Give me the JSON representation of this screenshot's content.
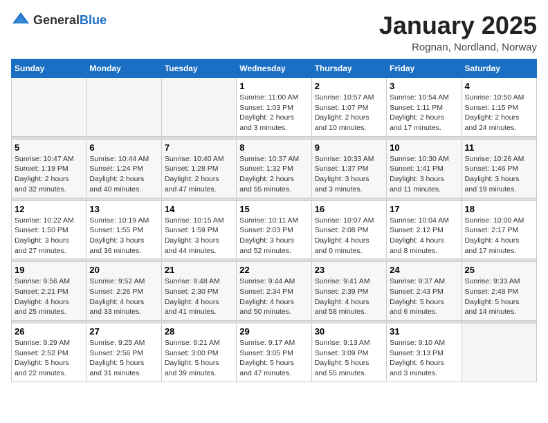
{
  "logo": {
    "general": "General",
    "blue": "Blue"
  },
  "title": "January 2025",
  "subtitle": "Rognan, Nordland, Norway",
  "headers": [
    "Sunday",
    "Monday",
    "Tuesday",
    "Wednesday",
    "Thursday",
    "Friday",
    "Saturday"
  ],
  "weeks": [
    {
      "days": [
        {
          "num": "",
          "info": "",
          "empty": true
        },
        {
          "num": "",
          "info": "",
          "empty": true
        },
        {
          "num": "",
          "info": "",
          "empty": true
        },
        {
          "num": "1",
          "info": "Sunrise: 11:00 AM\nSunset: 1:03 PM\nDaylight: 2 hours\nand 3 minutes."
        },
        {
          "num": "2",
          "info": "Sunrise: 10:57 AM\nSunset: 1:07 PM\nDaylight: 2 hours\nand 10 minutes."
        },
        {
          "num": "3",
          "info": "Sunrise: 10:54 AM\nSunset: 1:11 PM\nDaylight: 2 hours\nand 17 minutes."
        },
        {
          "num": "4",
          "info": "Sunrise: 10:50 AM\nSunset: 1:15 PM\nDaylight: 2 hours\nand 24 minutes."
        }
      ]
    },
    {
      "days": [
        {
          "num": "5",
          "info": "Sunrise: 10:47 AM\nSunset: 1:19 PM\nDaylight: 2 hours\nand 32 minutes."
        },
        {
          "num": "6",
          "info": "Sunrise: 10:44 AM\nSunset: 1:24 PM\nDaylight: 2 hours\nand 40 minutes."
        },
        {
          "num": "7",
          "info": "Sunrise: 10:40 AM\nSunset: 1:28 PM\nDaylight: 2 hours\nand 47 minutes."
        },
        {
          "num": "8",
          "info": "Sunrise: 10:37 AM\nSunset: 1:32 PM\nDaylight: 2 hours\nand 55 minutes."
        },
        {
          "num": "9",
          "info": "Sunrise: 10:33 AM\nSunset: 1:37 PM\nDaylight: 3 hours\nand 3 minutes."
        },
        {
          "num": "10",
          "info": "Sunrise: 10:30 AM\nSunset: 1:41 PM\nDaylight: 3 hours\nand 11 minutes."
        },
        {
          "num": "11",
          "info": "Sunrise: 10:26 AM\nSunset: 1:46 PM\nDaylight: 3 hours\nand 19 minutes."
        }
      ]
    },
    {
      "days": [
        {
          "num": "12",
          "info": "Sunrise: 10:22 AM\nSunset: 1:50 PM\nDaylight: 3 hours\nand 27 minutes."
        },
        {
          "num": "13",
          "info": "Sunrise: 10:19 AM\nSunset: 1:55 PM\nDaylight: 3 hours\nand 36 minutes."
        },
        {
          "num": "14",
          "info": "Sunrise: 10:15 AM\nSunset: 1:59 PM\nDaylight: 3 hours\nand 44 minutes."
        },
        {
          "num": "15",
          "info": "Sunrise: 10:11 AM\nSunset: 2:03 PM\nDaylight: 3 hours\nand 52 minutes."
        },
        {
          "num": "16",
          "info": "Sunrise: 10:07 AM\nSunset: 2:08 PM\nDaylight: 4 hours\nand 0 minutes."
        },
        {
          "num": "17",
          "info": "Sunrise: 10:04 AM\nSunset: 2:12 PM\nDaylight: 4 hours\nand 8 minutes."
        },
        {
          "num": "18",
          "info": "Sunrise: 10:00 AM\nSunset: 2:17 PM\nDaylight: 4 hours\nand 17 minutes."
        }
      ]
    },
    {
      "days": [
        {
          "num": "19",
          "info": "Sunrise: 9:56 AM\nSunset: 2:21 PM\nDaylight: 4 hours\nand 25 minutes."
        },
        {
          "num": "20",
          "info": "Sunrise: 9:52 AM\nSunset: 2:26 PM\nDaylight: 4 hours\nand 33 minutes."
        },
        {
          "num": "21",
          "info": "Sunrise: 9:48 AM\nSunset: 2:30 PM\nDaylight: 4 hours\nand 41 minutes."
        },
        {
          "num": "22",
          "info": "Sunrise: 9:44 AM\nSunset: 2:34 PM\nDaylight: 4 hours\nand 50 minutes."
        },
        {
          "num": "23",
          "info": "Sunrise: 9:41 AM\nSunset: 2:39 PM\nDaylight: 4 hours\nand 58 minutes."
        },
        {
          "num": "24",
          "info": "Sunrise: 9:37 AM\nSunset: 2:43 PM\nDaylight: 5 hours\nand 6 minutes."
        },
        {
          "num": "25",
          "info": "Sunrise: 9:33 AM\nSunset: 2:48 PM\nDaylight: 5 hours\nand 14 minutes."
        }
      ]
    },
    {
      "days": [
        {
          "num": "26",
          "info": "Sunrise: 9:29 AM\nSunset: 2:52 PM\nDaylight: 5 hours\nand 22 minutes."
        },
        {
          "num": "27",
          "info": "Sunrise: 9:25 AM\nSunset: 2:56 PM\nDaylight: 5 hours\nand 31 minutes."
        },
        {
          "num": "28",
          "info": "Sunrise: 9:21 AM\nSunset: 3:00 PM\nDaylight: 5 hours\nand 39 minutes."
        },
        {
          "num": "29",
          "info": "Sunrise: 9:17 AM\nSunset: 3:05 PM\nDaylight: 5 hours\nand 47 minutes."
        },
        {
          "num": "30",
          "info": "Sunrise: 9:13 AM\nSunset: 3:09 PM\nDaylight: 5 hours\nand 55 minutes."
        },
        {
          "num": "31",
          "info": "Sunrise: 9:10 AM\nSunset: 3:13 PM\nDaylight: 6 hours\nand 3 minutes."
        },
        {
          "num": "",
          "info": "",
          "empty": true
        }
      ]
    }
  ]
}
